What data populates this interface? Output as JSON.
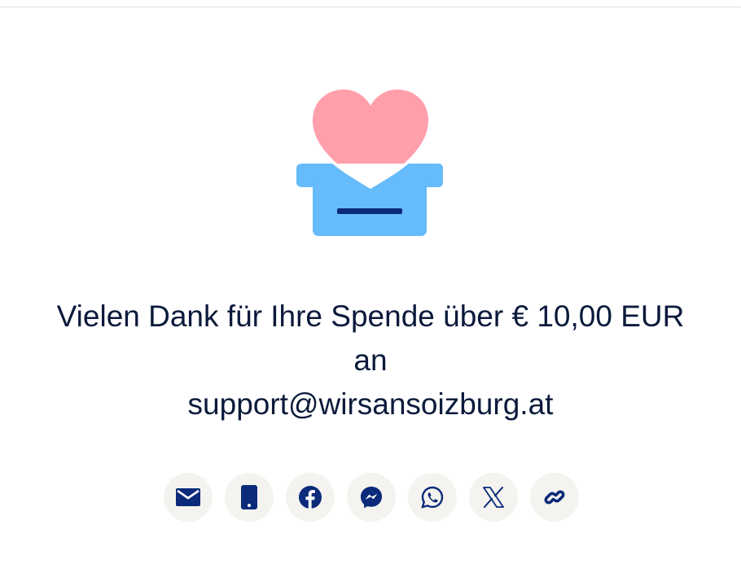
{
  "message": {
    "line1": "Vielen Dank für Ihre Spende über € 10,00 EUR",
    "line2": "an",
    "line3": "support@wirsansoizburg.at"
  },
  "share": {
    "buttons": [
      {
        "icon": "email-icon"
      },
      {
        "icon": "mobile-phone-icon"
      },
      {
        "icon": "facebook-icon"
      },
      {
        "icon": "messenger-icon"
      },
      {
        "icon": "whatsapp-icon"
      },
      {
        "icon": "x-icon"
      },
      {
        "icon": "link-icon"
      }
    ]
  },
  "colors": {
    "heart": "#ff9fab",
    "box": "#66bbfa",
    "slot": "#0b2a7a",
    "icon": "#0b2a7a",
    "text": "#0b1a3b",
    "button_bg": "#f4f3ef"
  }
}
